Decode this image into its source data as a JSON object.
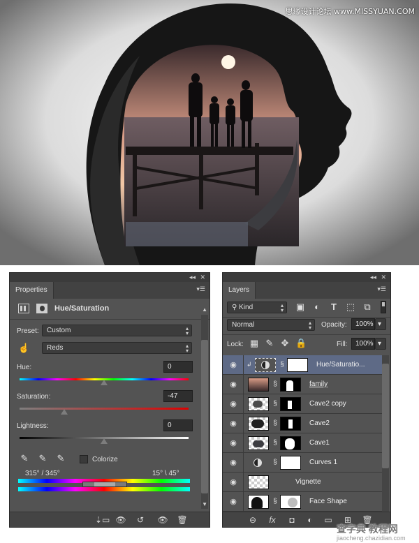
{
  "watermark_top": "思缘设计论坛 www.MISSYUAN.COM",
  "watermark_bottom": {
    "brand": "查字典 教程网",
    "url": "jiaocheng.chazidian.com"
  },
  "properties": {
    "tab": "Properties",
    "adjustment_title": "Hue/Saturation",
    "preset_label": "Preset:",
    "preset_value": "Custom",
    "channel_value": "Reds",
    "hue_label": "Hue:",
    "hue_value": "0",
    "saturation_label": "Saturation:",
    "saturation_value": "-47",
    "lightness_label": "Lightness:",
    "lightness_value": "0",
    "colorize_label": "Colorize",
    "range_left": "315° / 345°",
    "range_right": "15° \\ 45°"
  },
  "layers": {
    "tab": "Layers",
    "filter_kind": "Kind",
    "blend_mode": "Normal",
    "opacity_label": "Opacity:",
    "opacity_value": "100%",
    "lock_label": "Lock:",
    "fill_label": "Fill:",
    "fill_value": "100%",
    "items": [
      {
        "name": "Hue/Saturatio...",
        "selected": true
      },
      {
        "name": "family",
        "selected": false
      },
      {
        "name": "Cave2 copy",
        "selected": false
      },
      {
        "name": "Cave2",
        "selected": false
      },
      {
        "name": "Cave1",
        "selected": false
      },
      {
        "name": "Curves 1",
        "selected": false
      },
      {
        "name": "Vignette",
        "selected": false
      },
      {
        "name": "Face Shape",
        "selected": false
      }
    ]
  },
  "icons": {
    "collapse": "collapse-icon",
    "close": "close-icon",
    "menu": "panel-menu-icon",
    "eye": "eye-icon",
    "link": "link-icon"
  }
}
